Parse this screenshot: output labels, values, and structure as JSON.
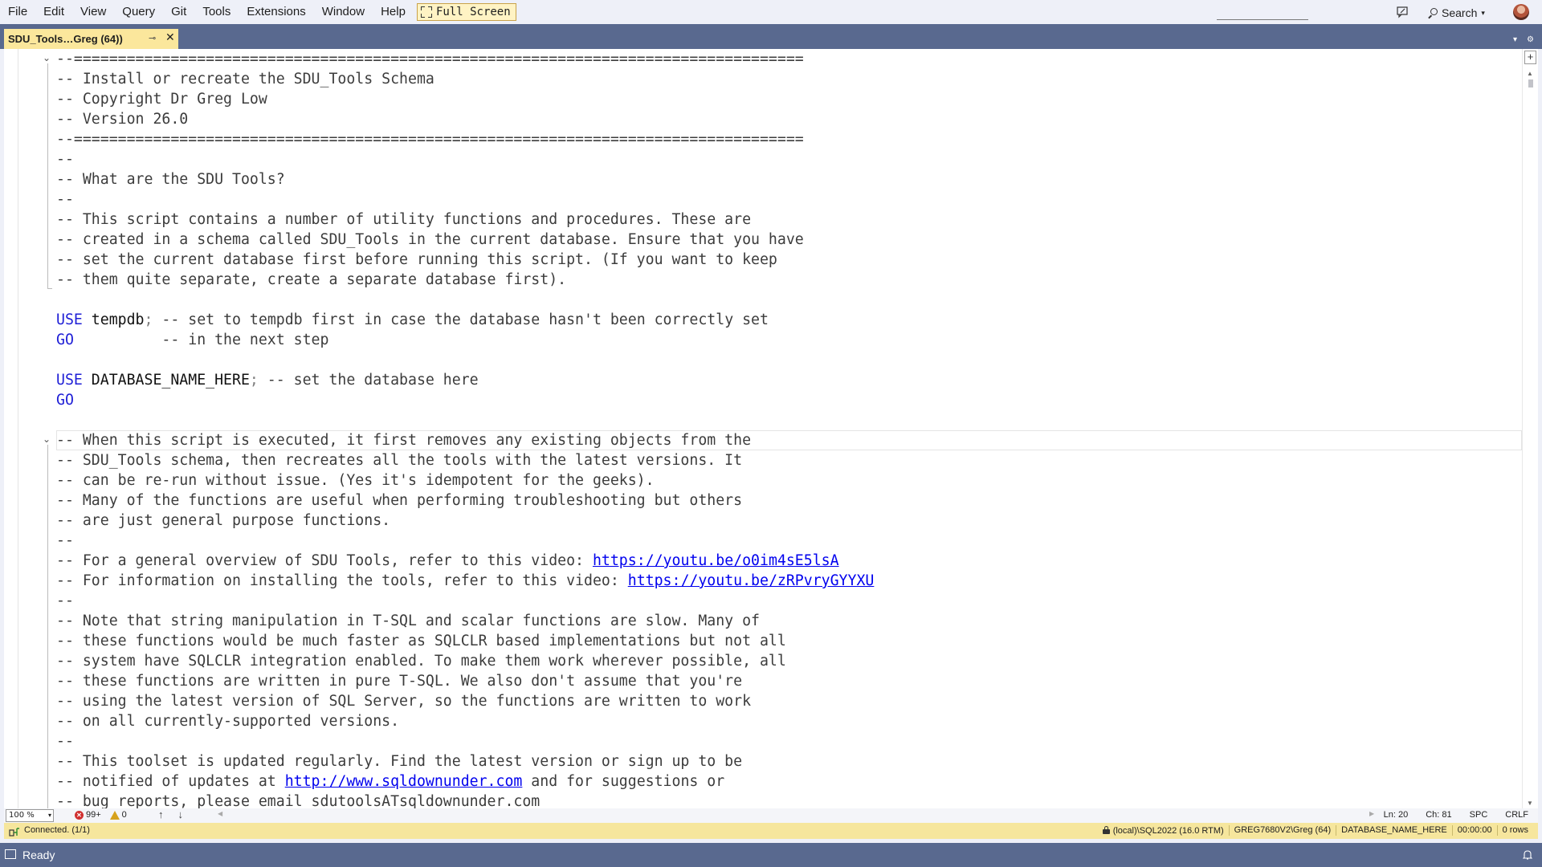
{
  "menu": {
    "items": [
      "File",
      "Edit",
      "View",
      "Query",
      "Git",
      "Tools",
      "Extensions",
      "Window",
      "Help"
    ],
    "fullscreen_label": "Full Screen",
    "search_label": "Search"
  },
  "tab": {
    "title": "SDU_Tools…Greg (64))",
    "pin_glyph": "⊸",
    "close_glyph": "✕"
  },
  "editor": {
    "lines": [
      [
        {
          "t": "--===================================================================================",
          "k": "comment"
        }
      ],
      [
        {
          "t": "-- Install or recreate the SDU_Tools Schema",
          "k": "comment"
        }
      ],
      [
        {
          "t": "-- Copyright Dr Greg Low",
          "k": "comment"
        }
      ],
      [
        {
          "t": "-- Version 26.0",
          "k": "comment"
        }
      ],
      [
        {
          "t": "--===================================================================================",
          "k": "comment"
        }
      ],
      [
        {
          "t": "--",
          "k": "comment"
        }
      ],
      [
        {
          "t": "-- What are the SDU Tools?",
          "k": "comment"
        }
      ],
      [
        {
          "t": "--",
          "k": "comment"
        }
      ],
      [
        {
          "t": "-- This script contains a number of utility functions and procedures. These are",
          "k": "comment"
        }
      ],
      [
        {
          "t": "-- created in a schema called SDU_Tools in the current database. Ensure that you have",
          "k": "comment"
        }
      ],
      [
        {
          "t": "-- set the current database first before running this script. (If you want to keep",
          "k": "comment"
        }
      ],
      [
        {
          "t": "-- them quite separate, create a separate database first).",
          "k": "comment"
        }
      ],
      [],
      [
        {
          "t": "USE",
          "k": "kw"
        },
        {
          "t": " tempdb",
          "k": "id"
        },
        {
          "t": ";",
          "k": "punct"
        },
        {
          "t": " -- set to tempdb first in case the database hasn't been correctly set",
          "k": "comment"
        }
      ],
      [
        {
          "t": "GO",
          "k": "kw"
        },
        {
          "t": "          -- in the next step",
          "k": "comment"
        }
      ],
      [],
      [
        {
          "t": "USE",
          "k": "kw"
        },
        {
          "t": " DATABASE_NAME_HERE",
          "k": "id"
        },
        {
          "t": ";",
          "k": "punct"
        },
        {
          "t": " -- set the database here",
          "k": "comment"
        }
      ],
      [
        {
          "t": "GO",
          "k": "kw"
        }
      ],
      [],
      [
        {
          "t": "-- When this script is executed, it first removes any existing objects from the",
          "k": "comment"
        }
      ],
      [
        {
          "t": "-- SDU_Tools schema, then recreates all the tools with the latest versions. It",
          "k": "comment"
        }
      ],
      [
        {
          "t": "-- can be re-run without issue. (Yes it's idempotent for the geeks).",
          "k": "comment"
        }
      ],
      [
        {
          "t": "-- Many of the functions are useful when performing troubleshooting but others",
          "k": "comment"
        }
      ],
      [
        {
          "t": "-- are just general purpose functions.",
          "k": "comment"
        }
      ],
      [
        {
          "t": "--",
          "k": "comment"
        }
      ],
      [
        {
          "t": "-- For a general overview of SDU Tools, refer to this video: ",
          "k": "comment"
        },
        {
          "t": "https://youtu.be/o0im4sE5lsA",
          "k": "link"
        }
      ],
      [
        {
          "t": "-- For information on installing the tools, refer to this video: ",
          "k": "comment"
        },
        {
          "t": "https://youtu.be/zRPvryGYYXU",
          "k": "link"
        }
      ],
      [
        {
          "t": "--",
          "k": "comment"
        }
      ],
      [
        {
          "t": "-- Note that string manipulation in T-SQL and scalar functions are slow. Many of",
          "k": "comment"
        }
      ],
      [
        {
          "t": "-- these functions would be much faster as SQLCLR based implementations but not all",
          "k": "comment"
        }
      ],
      [
        {
          "t": "-- system have SQLCLR integration enabled. To make them work wherever possible, all",
          "k": "comment"
        }
      ],
      [
        {
          "t": "-- these functions are written in pure T-SQL. We also don't assume that you're",
          "k": "comment"
        }
      ],
      [
        {
          "t": "-- using the latest version of SQL Server, so the functions are written to work",
          "k": "comment"
        }
      ],
      [
        {
          "t": "-- on all currently-supported versions.",
          "k": "comment"
        }
      ],
      [
        {
          "t": "--",
          "k": "comment"
        }
      ],
      [
        {
          "t": "-- This toolset is updated regularly. Find the latest version or sign up to be",
          "k": "comment"
        }
      ],
      [
        {
          "t": "-- notified of updates at ",
          "k": "comment"
        },
        {
          "t": "http://www.sqldownunder.com",
          "k": "link"
        },
        {
          "t": " and for suggestions or",
          "k": "comment"
        }
      ],
      [
        {
          "t": "-- bug reports, please email sdutoolsATsqldownunder.com",
          "k": "comment"
        }
      ]
    ]
  },
  "editor_status": {
    "zoom": "100 %",
    "errors": "99+",
    "warnings": "0",
    "ln": "Ln: 20",
    "ch": "Ch: 81",
    "spc": "SPC",
    "crlf": "CRLF"
  },
  "connection": {
    "status": "Connected. (1/1)",
    "server": "(local)\\SQL2022 (16.0 RTM)",
    "user": "GREG7680V2\\Greg (64)",
    "database": "DATABASE_NAME_HERE",
    "elapsed": "00:00:00",
    "rows": "0 rows"
  },
  "statusbar": {
    "ready": "Ready"
  },
  "colors": {
    "menu_bg": "#eef0f8",
    "chrome_blue": "#59698f",
    "tab_active": "#fbe79c",
    "conn_yellow": "#f6e69d",
    "keyword": "#1f1fd6",
    "link": "#0000ee"
  }
}
